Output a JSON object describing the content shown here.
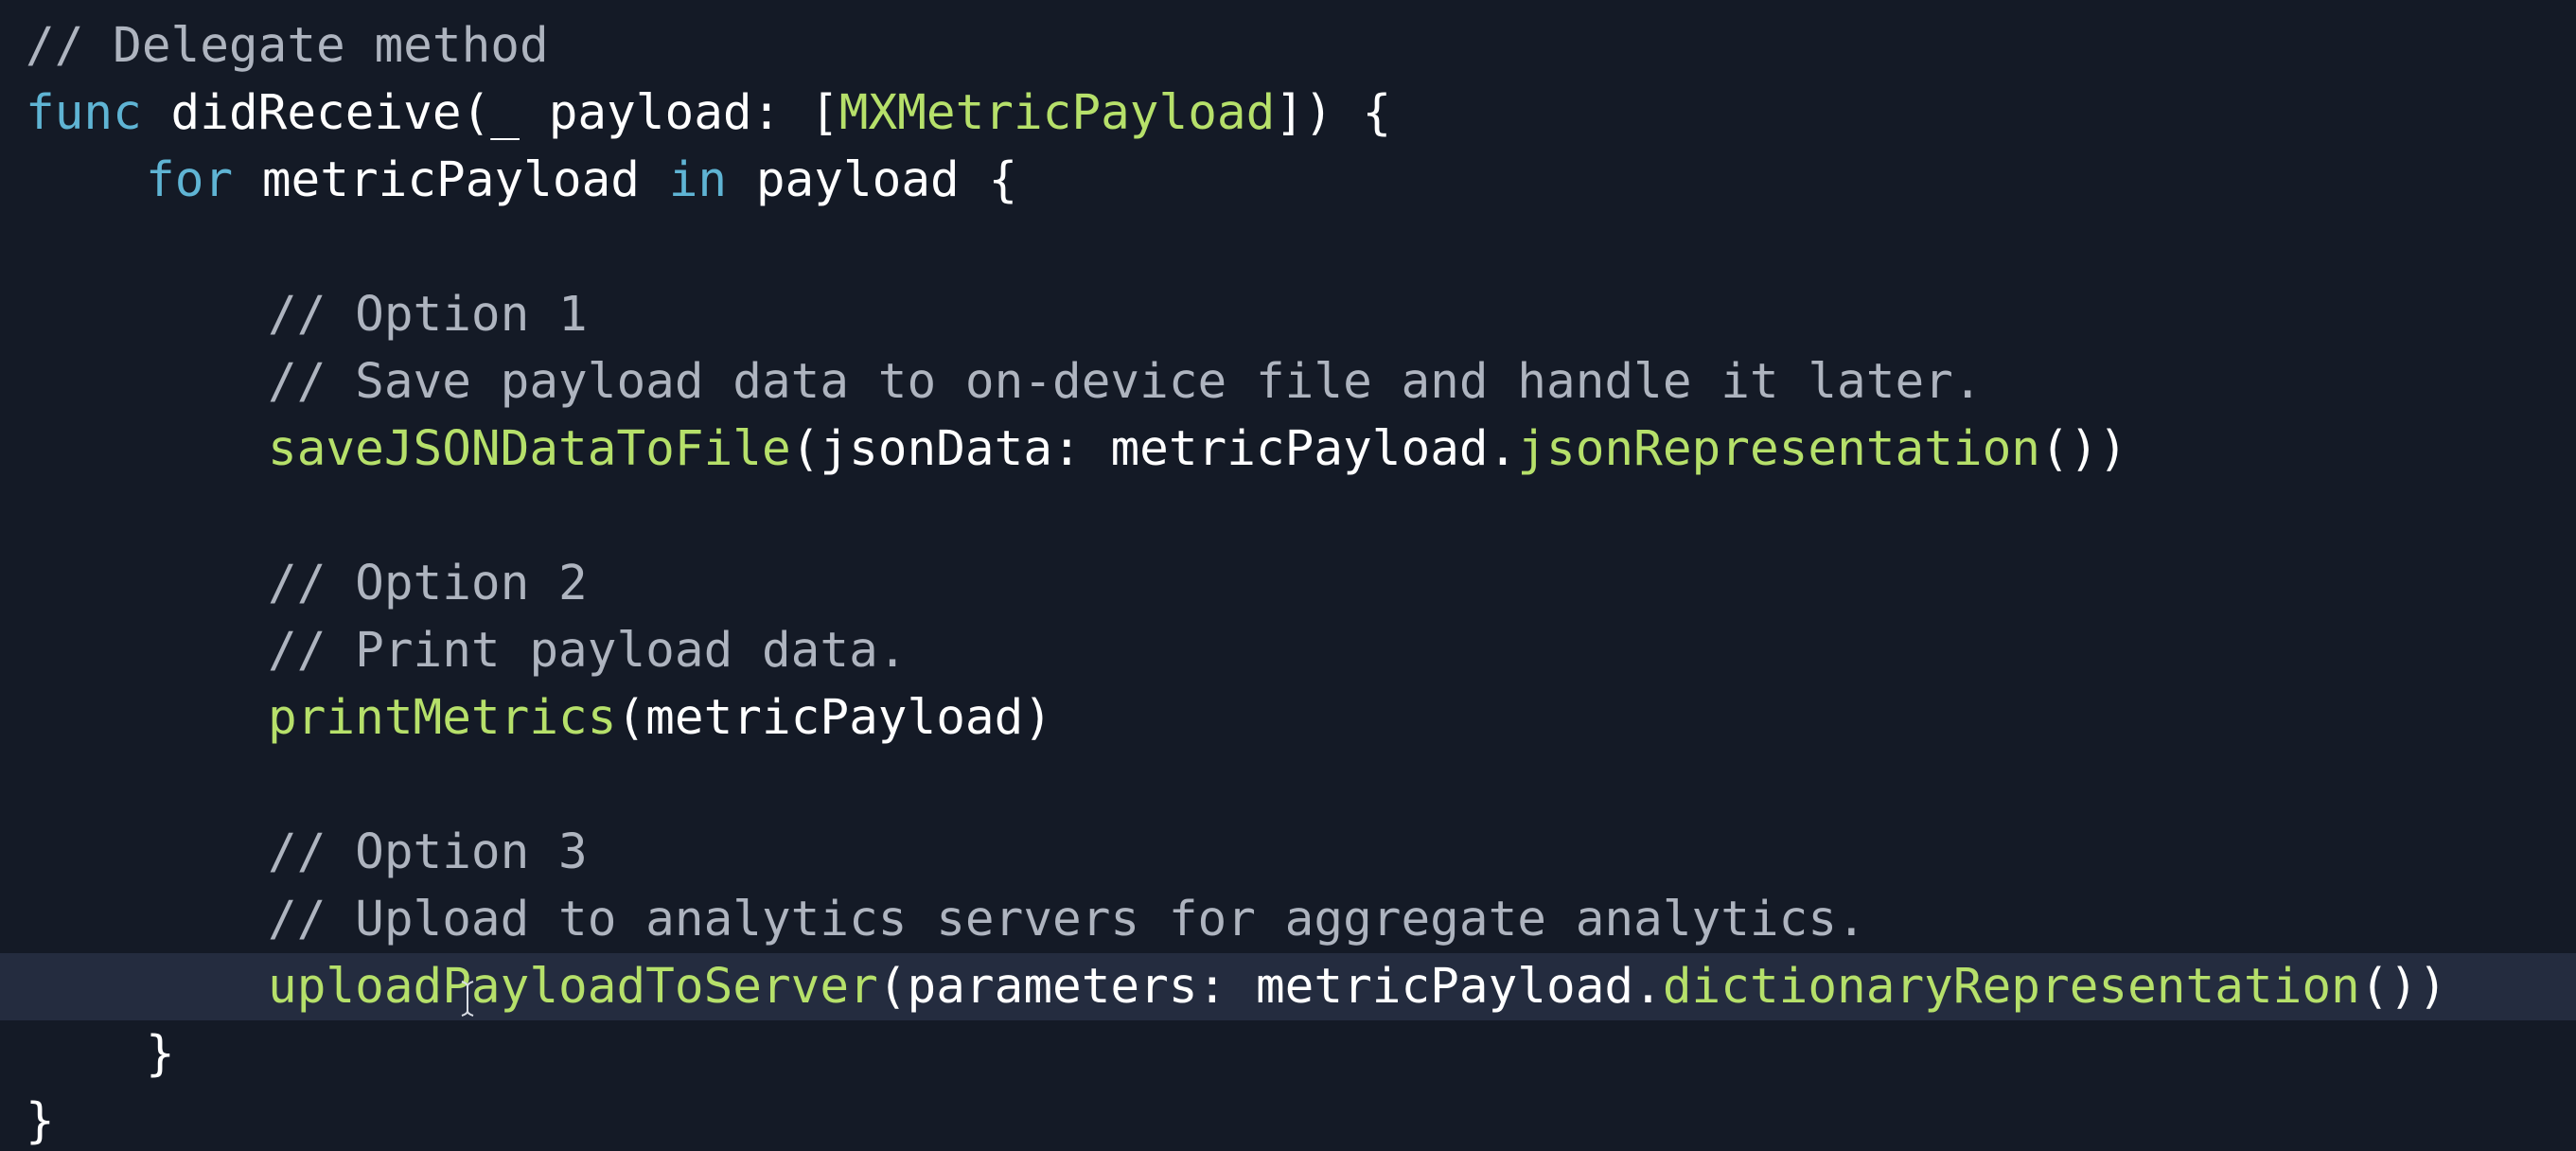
{
  "editor": {
    "colors": {
      "background": "#141a26",
      "current_line": "#242c3f",
      "comment": "#aeb4bf",
      "keyword": "#5fb4d4",
      "type_and_function": "#b6e06a",
      "plain": "#ffffff"
    },
    "current_line_index": 14,
    "lines": [
      {
        "tokens": [
          {
            "kind": "comment",
            "text": "// Delegate method"
          }
        ]
      },
      {
        "tokens": [
          {
            "kind": "keyword",
            "text": "func"
          },
          {
            "kind": "plain",
            "text": " didReceive(_ payload: ["
          },
          {
            "kind": "type",
            "text": "MXMetricPayload"
          },
          {
            "kind": "plain",
            "text": "]) {"
          }
        ]
      },
      {
        "tokens": [
          {
            "kind": "keyword",
            "text": "for"
          },
          {
            "kind": "plain",
            "text": " metricPayload "
          },
          {
            "kind": "keyword",
            "text": "in"
          },
          {
            "kind": "plain",
            "text": " payload {"
          }
        ]
      },
      {
        "tokens": []
      },
      {
        "tokens": [
          {
            "kind": "comment",
            "text": "// Option 1"
          }
        ]
      },
      {
        "tokens": [
          {
            "kind": "comment",
            "text": "// Save payload data to on-device file and handle it later."
          }
        ]
      },
      {
        "tokens": [
          {
            "kind": "function",
            "text": "saveJSONDataToFile"
          },
          {
            "kind": "plain",
            "text": "(jsonData: metricPayload."
          },
          {
            "kind": "function",
            "text": "jsonRepresentation"
          },
          {
            "kind": "plain",
            "text": "())"
          }
        ]
      },
      {
        "tokens": []
      },
      {
        "tokens": [
          {
            "kind": "comment",
            "text": "// Option 2"
          }
        ]
      },
      {
        "tokens": [
          {
            "kind": "comment",
            "text": "// Print payload data."
          }
        ]
      },
      {
        "tokens": [
          {
            "kind": "function",
            "text": "printMetrics"
          },
          {
            "kind": "plain",
            "text": "(metricPayload)"
          }
        ]
      },
      {
        "tokens": []
      },
      {
        "tokens": [
          {
            "kind": "comment",
            "text": "// Option 3"
          }
        ]
      },
      {
        "tokens": [
          {
            "kind": "comment",
            "text": "// Upload to analytics servers for aggregate analytics."
          }
        ]
      },
      {
        "tokens": [
          {
            "kind": "function",
            "text": "uploadPayloadToServer"
          },
          {
            "kind": "plain",
            "text": "(parameters: metricPayload."
          },
          {
            "kind": "function",
            "text": "dictionaryRepresentation"
          },
          {
            "kind": "plain",
            "text": "())"
          }
        ]
      },
      {
        "tokens": [
          {
            "kind": "plain",
            "text": "}"
          }
        ]
      },
      {
        "tokens": [
          {
            "kind": "plain",
            "text": "}"
          }
        ]
      }
    ]
  }
}
